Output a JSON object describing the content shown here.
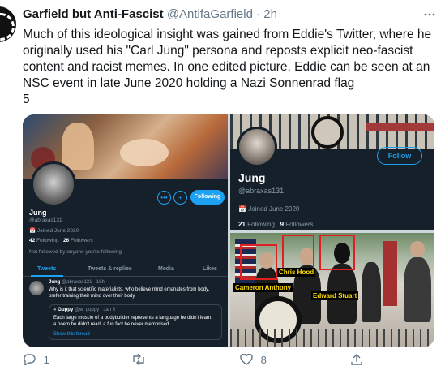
{
  "tweet": {
    "display_name": "Garfield but Anti-Fascist",
    "handle": "@AntifaGarfield",
    "separator": "·",
    "time": "2h",
    "text": "Much of this ideological insight was gained from Eddie's Twitter, where he originally used his \"Carl Jung\" persona and reposts explicit neo-fascist content and racist memes. In one edited picture, Eddie can be seen at an NSC event in late June 2020 holding a Nazi Sonnenrad flag",
    "thread_number": "5",
    "more_icon": "more-horizontal-icon"
  },
  "left_panel": {
    "profile_name": "Jung",
    "profile_handle": "@abraxas131",
    "joined": "Joined June 2020",
    "following_count": "42",
    "following_label": "Following",
    "followers_count": "26",
    "followers_label": "Followers",
    "not_followed_note": "Not followed by anyone you're following",
    "follow_button": "Following",
    "tabs": [
      "Tweets",
      "Tweets & replies",
      "Media",
      "Likes"
    ],
    "inner_tweet": {
      "name": "Jung",
      "meta": "@abraxas131 · 18h",
      "text": "Why is it that scientific materialists, who believe mind emanates from body, prefer training their mind over their body"
    },
    "quoted": {
      "name": "Guppy",
      "meta": "@w_guppy · Jan 3",
      "text": "Each large muscle of a bodybuilder represents a language he didn't learn, a poem he didn't read, a fun fact he never memorised.",
      "link": "Show this thread"
    }
  },
  "right_top_panel": {
    "profile_name": "Jung",
    "profile_handle": "@abraxas131",
    "joined": "Joined June 2020",
    "following_count": "21",
    "following_label": "Following",
    "followers_count": "9",
    "followers_label": "Followers",
    "follow_button": "Follow"
  },
  "right_bottom_panel": {
    "labels": [
      "Chris Hood",
      "Cameron Anthony",
      "Edward Stuart"
    ]
  },
  "actions": {
    "reply_count": "1",
    "retweet_count": "",
    "like_count": "8",
    "share_count": ""
  },
  "colors": {
    "accent": "#1da1f2",
    "dark_bg": "#15202b",
    "label_text": "#ffe000",
    "highlight_box": "#e02020"
  }
}
